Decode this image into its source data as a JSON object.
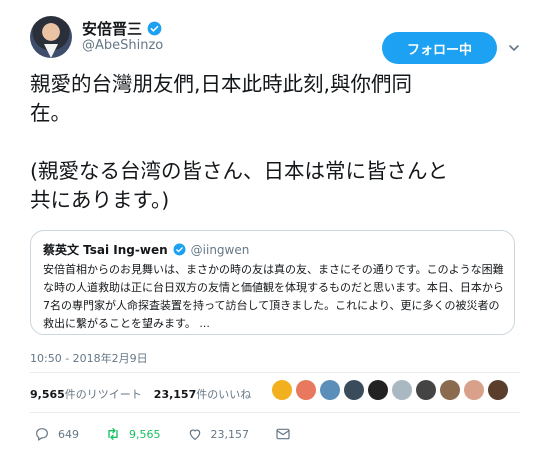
{
  "user": {
    "display_name": "安倍晋三",
    "handle": "@AbeShinzo",
    "follow_label": "フォロー中"
  },
  "tweet": {
    "text": "親愛的台灣朋友們,日本此時此刻,與你們同\n在。\n\n(親愛なる台湾の皆さん、日本は常に皆さんと\n共にあります。)"
  },
  "quoted": {
    "name": "蔡英文 Tsai Ing-wen",
    "handle": "@iingwen",
    "text": "安倍首相からのお見舞いは、まさかの時の友は真の友、まさにその通りです。このような困難な時の人道救助は正に台日双方の友情と価値観を体現するものだと思います。本日、日本から7名の専門家が人命探査装置を持って訪台して頂きました。これにより、更に多くの被災者の救出に繋がることを望みます。 ..."
  },
  "timestamp": "10:50 - 2018年2月9日",
  "stats": {
    "retweet_count": "9,565",
    "retweet_label": "件のリツイート",
    "like_count": "23,157",
    "like_label": "件のいいね"
  },
  "likers": [
    {
      "icon": "liker-avatar",
      "color": "#f2b01e"
    },
    {
      "icon": "liker-avatar",
      "color": "#e8785e"
    },
    {
      "icon": "liker-avatar",
      "color": "#5b8fb9"
    },
    {
      "icon": "liker-avatar",
      "color": "#3a4b5c"
    },
    {
      "icon": "liker-avatar",
      "color": "#222222"
    },
    {
      "icon": "liker-avatar",
      "color": "#aab8c2"
    },
    {
      "icon": "liker-avatar",
      "color": "#444444"
    },
    {
      "icon": "liker-avatar",
      "color": "#8b6b4f"
    },
    {
      "icon": "liker-avatar",
      "color": "#d9a08a"
    },
    {
      "icon": "liker-avatar",
      "color": "#5a3d2b"
    }
  ],
  "actions": {
    "reply_count": "649",
    "retweet_count": "9,565",
    "like_count": "23,157"
  },
  "colors": {
    "accent": "#1da1f2",
    "retweet": "#17bf63",
    "secondary_text": "#657786"
  }
}
